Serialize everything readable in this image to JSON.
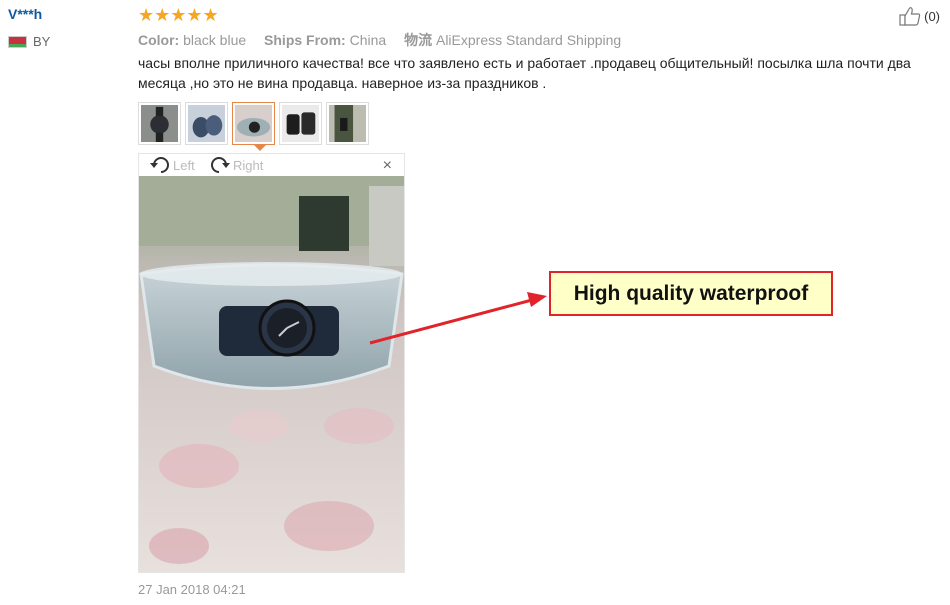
{
  "reviewer": {
    "name": "V***h",
    "country": "BY"
  },
  "rating": {
    "stars_text": "★★★★★",
    "value": 5
  },
  "properties": {
    "color_label": "Color:",
    "color_value": "black blue",
    "ships_label": "Ships From:",
    "ships_value": "China",
    "logistics_label": "物流",
    "logistics_value": "AliExpress Standard Shipping"
  },
  "like": {
    "count": "(0)",
    "icon": "thumbs-up-icon"
  },
  "review_text": "часы вполне приличного качества! все что заявлено есть и работает .продавец общительный! посылка шла почти два месяца ,но это не вина продавца. наверное из-за праздников .",
  "thumbnails": [
    {
      "selected": false
    },
    {
      "selected": false
    },
    {
      "selected": true
    },
    {
      "selected": false
    },
    {
      "selected": false
    }
  ],
  "viewer": {
    "rotate_left": "Left",
    "rotate_right": "Right",
    "close": "×"
  },
  "date": "27 Jan 2018 04:21",
  "callout": {
    "text": "High quality waterproof"
  },
  "colors": {
    "accent": "#f5a623",
    "link": "#0f5a9c",
    "callout_border": "#e0242a",
    "callout_bg": "#ffffc8"
  }
}
